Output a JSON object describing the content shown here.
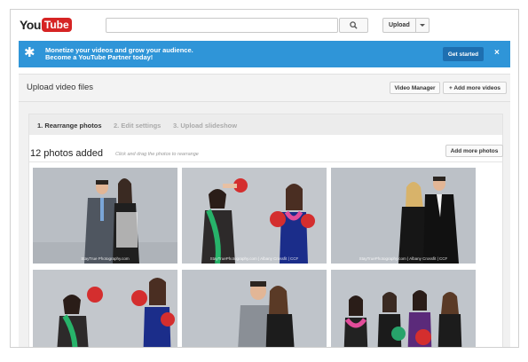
{
  "header": {
    "logo_you": "You",
    "logo_tube": "Tube",
    "search_placeholder": "",
    "upload_label": "Upload"
  },
  "banner": {
    "line1": "Monetize your videos and grow your audience.",
    "line2": "Become a YouTube Partner today!",
    "cta": "Get started",
    "close": "×"
  },
  "panel": {
    "title": "Upload video files",
    "video_manager": "Video Manager",
    "add_more_videos": "+ Add more videos"
  },
  "wizard": {
    "steps": [
      "1. Rearrange photos",
      "2. Edit settings",
      "3. Upload slideshow"
    ],
    "active_step": 0,
    "count_label": "12 photos added",
    "hint": "Click and drag the photos to rearrange",
    "add_more_photos": "Add more photos"
  },
  "photos": [
    {
      "watermark": "StayTrue Photography.com"
    },
    {
      "watermark": "StayTruePhotography.com | Albany Crossfit | CCF"
    },
    {
      "watermark": "StayTruePhotography.com | Albany Crossfit | CCF"
    },
    {
      "watermark": ""
    },
    {
      "watermark": ""
    },
    {
      "watermark": ""
    }
  ],
  "colors": {
    "brand_red": "#d62424",
    "banner_blue": "#2f95d8",
    "banner_button": "#1e6fb0"
  }
}
